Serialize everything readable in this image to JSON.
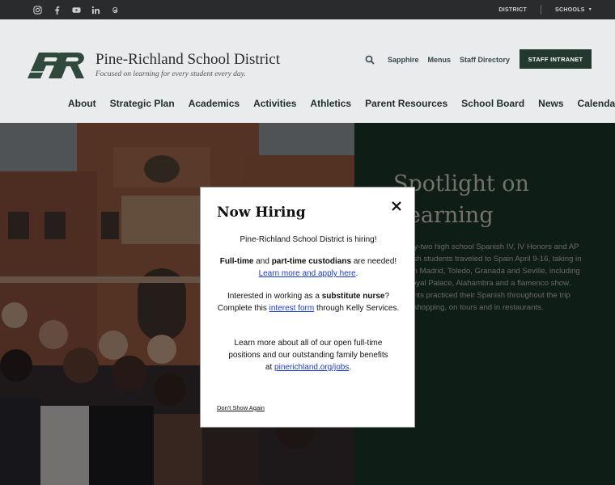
{
  "topbar": {
    "social": [
      "instagram-icon",
      "facebook-icon",
      "youtube-icon",
      "linkedin-icon",
      "threads-icon"
    ],
    "district_label": "DISTRICT",
    "schools_label": "SCHOOLS"
  },
  "header": {
    "title": "Pine-Richland School District",
    "tagline": "Focused on learning for every student every day.",
    "utility": [
      "Sapphire",
      "Menus",
      "Staff Directory"
    ],
    "intranet_label": "STAFF INTRANET",
    "nav": [
      "About",
      "Strategic Plan",
      "Academics",
      "Activities",
      "Athletics",
      "Parent Resources",
      "School Board",
      "News",
      "Calendar"
    ]
  },
  "spotlight": {
    "title_line1": "Spotlight on",
    "title_line2": "Learning",
    "body": "Twenty-two high school Spanish IV, IV Honors and AP Spanish students traveled to Spain April 9-16, taking in sites in Madrid, Toledo, Granada and Seville, including the Royal Palace, Alahambra and a flamenco show. Students practiced their Spanish throughout the trip while shopping, on tours and in restaurants."
  },
  "modal": {
    "title": "Now Hiring",
    "p1": "Pine-Richland School District is hiring!",
    "p2_a": "Full-time",
    "p2_b": " and ",
    "p2_c": "part-time custodians",
    "p2_d": " are needed!",
    "p2_link": "Learn more and apply here",
    "p2_end": ".",
    "p3_a": "Interested in working as a ",
    "p3_b": "substitute nurse",
    "p3_c": "? Complete this ",
    "p3_link": "interest form",
    "p3_d": " through Kelly Services.",
    "p4_a": "Learn more about all of our open full-time positions and our outstanding family benefits at ",
    "p4_link": "pinerichland.org/jobs",
    "p4_end": ".",
    "dont_show": "Don't Show Again"
  },
  "colors": {
    "brand_green": "#1f3a2f",
    "topbar": "#2a2b2c",
    "link": "#1a3ad0"
  }
}
